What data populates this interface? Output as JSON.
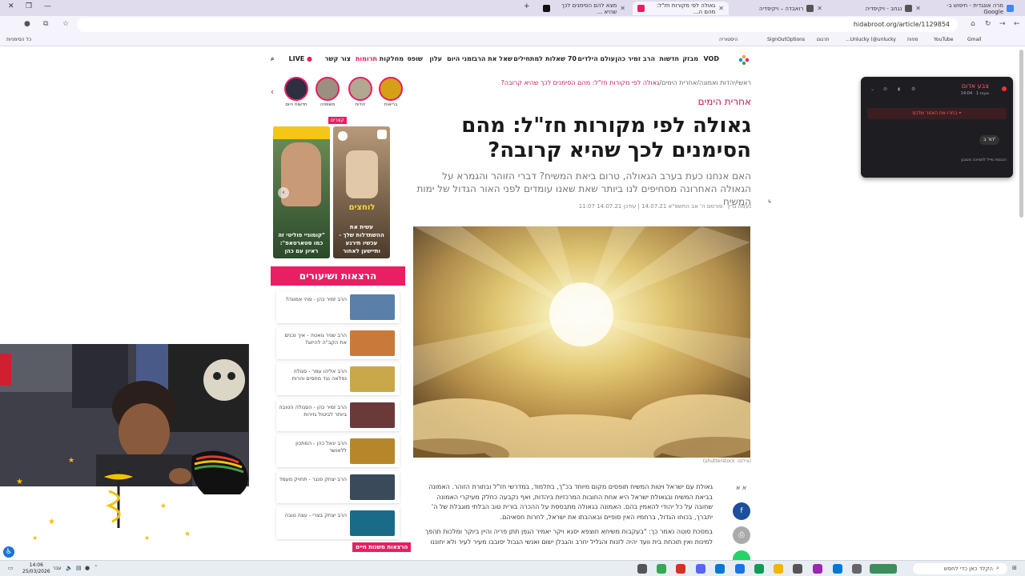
{
  "browser": {
    "tabs": [
      {
        "label": "מרה אונגדית - חיפוש ב-Google"
      },
      {
        "label": "נגחב - ויקיפדיה"
      },
      {
        "label": "רואבדה – ויקיפדיה"
      },
      {
        "label": "גאולה לפי מקורות חז\"ל: מהם ה...",
        "active": true
      },
      {
        "label": "מצא להם הסימנים לכך שהיא ..."
      }
    ],
    "url": "hidabroot.org/article/1129854",
    "bookmarks": {
      "all_bookmarks": "כל הסימניות",
      "items": [
        "Gmail",
        "YouTube",
        "Unlucky (@unlucky...",
        "תרגום",
        "SignOutOptions",
        "היסטוריה",
        "מפות"
      ]
    }
  },
  "site": {
    "nav": [
      "VOD",
      "מבזק",
      "חדשות",
      "הרב זמיר כהן",
      "עולם הילדים",
      "70 שאלות",
      "למתחילים",
      "שאל את הרב",
      "זמני היום",
      "עלון",
      "שופס",
      "מחלקות",
      "תרומות",
      "צור קשר",
      "LIVE"
    ],
    "nav_highlight": "תרומות",
    "breadcrumb": {
      "home": "ראשי",
      "section": "יהדות ואמונה",
      "subsection": "אחרית הימים",
      "current": "גאולה לפי מקורות חז\"ל: מהם הסימנים לכך שהיא קרובה?"
    },
    "category": "אחרית הימים",
    "headline": "גאולה לפי מקורות חז\"ל: מהם הסימנים לכך שהיא קרובה?",
    "subheadline": "האם אנחנו כעת בערב הגאולה, טרום ביאת המשיח? דברי הזוהר והגמרא על הגאולה האחרונה מסחיפים לנו ביותר שאת שאנו עומדים לפני האור הגדול של ימות המשיח",
    "meta": {
      "author": "נעמה גרין",
      "published": "פורסם ה' אב התשפ\"א 14.07.21",
      "updated": "עודכן 14.07.21 11:07"
    },
    "image_credit": "(צילום: shutterstock)",
    "font_size_label": "א א",
    "body": [
      "גאולת עם ישראל ויטות המשיח תופסים מקום מיוחד בכ\"ך, בתלמוד, במדרשי חז\"ל ובתורת הזוהר. האמונה בביאת המשיח ובגאולת ישראל היא אחת החובות המרכזיות ביהדות, ואף נקבעה כחלק מעיקרי האמונה שחובה על כל יהודי להאמין בהם. האמונה בגאולה מתבססת על ההכרה בורית טוב הבלתי מוגבלת של ה' יתברך, בכוחו הגדול, ברחמיו האין סופיים ובאהבתו את ישראל, לחרות חסאיהם.",
      "במסכת סוטה נאמר כך: \"בעקבות משיחא חוצפא יסגא ויקר יאמיר הגפן תתן פריה והיין ביוקר ומלכות תהפך למינות ואין תוכחת בית וועד יהיה לזנות והגליל יחרב והגבלן ישום ואנשי הגבול יסובבו מעיר לעיר ולא יחוננו"
    ],
    "stories": [
      {
        "label": "בריאות",
        "color": "#d4a017"
      },
      {
        "label": "יהדות",
        "color": "#b0a890"
      },
      {
        "label": "משפחה",
        "color": "#9a9080"
      },
      {
        "label": "חדשות היום",
        "color": "#2c3040"
      }
    ],
    "shorts_tag": "קצרים",
    "reels": [
      {
        "caption": "עשית את ההשתדלות שלך - עכשיו תירגע ותיישען לאחור",
        "overlay": "לוחצים"
      },
      {
        "caption": "\"קומוניי פוליטי זה כמו סטארטאפ\": ראיון עם כהן"
      }
    ],
    "lectures_title": "הרצאות ושיעורים",
    "lectures": [
      {
        "title": "הרב זמיר כהן - מהי אמונה?",
        "color": "#5a7fa8"
      },
      {
        "title": "הרב שניר גואטה - איך נכנים את הקב\"ה להיזוג?",
        "color": "#c97a3a"
      },
      {
        "title": "הרב אליהו עמר - סגולה נפלאה נגד מחסים והרות",
        "color": "#c9a84a"
      },
      {
        "title": "הרב זמיר כהן - הסגולה הטובה ביותר לביטול גזירות",
        "color": "#6a3a3a"
      },
      {
        "title": "הרב יגאל כהן - המתכון ללאושר",
        "color": "#b8862a"
      },
      {
        "title": "הרב יצחק פנגר - תחויק מעמד",
        "color": "#3a4a5a"
      },
      {
        "title": "הרב יצחק בצרי - עצה טובה",
        "color": "#1a6a8a"
      }
    ],
    "lectures_more": "הרצאות משנות חיים"
  },
  "popup": {
    "title": "צבע אדום",
    "time": "14:04 · 1 שעות",
    "action": "בחרו את האזור שלכם",
    "tag": "דור ב'",
    "footer": "הכנסת מייל לתמיכה מטבע"
  },
  "taskbar": {
    "search_placeholder": "הקלד כאן כדי לחפש",
    "time": "14:06",
    "date": "25/03/2026",
    "lang": "עבר"
  },
  "colors": {
    "accent": "#e91e63",
    "headline_red": "#c2185b"
  }
}
